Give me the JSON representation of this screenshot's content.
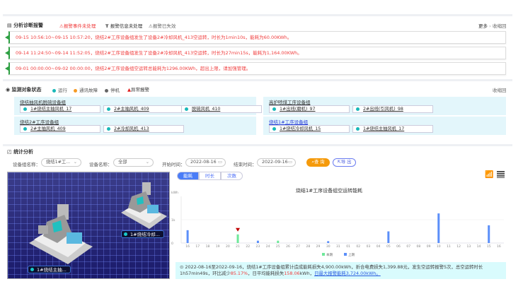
{
  "alarm_panel": {
    "title": "分析诊断报警",
    "filters": [
      {
        "label": "报警事件未处理",
        "icon": "warning-icon",
        "color": "#f04040"
      },
      {
        "label": "报警信息未处理",
        "icon": "text-icon",
        "color": "#333333"
      },
      {
        "label": "报警已失效",
        "icon": "warning-outline-icon",
        "color": "#666666"
      }
    ],
    "more": "更多",
    "collapse": "收缩回",
    "alarms": [
      "09-15 10:56:10~09-15 10:57:20，烧结2#工序设备组发生了设备2#冷却风机_413空运转，时长为1min10s，能耗为60.00KWh。",
      "09-14 11:24:50~09-14 11:52:05，烧结2#工序设备组发生了设备2#冷却风机_413空运转，时长为27min15s，能耗为1,164.00KWh。",
      "09-01 00:00:00~09-02 00:00:00，烧结2#工序设备组空运转总能耗为1296.00KWh，超出上限，请加强管理。"
    ]
  },
  "monitor_panel": {
    "title": "监测对象状态",
    "legend": [
      {
        "label": "运行",
        "color": "#19b8b8"
      },
      {
        "label": "通讯故障",
        "color": "#f59a23"
      },
      {
        "label": "停机",
        "color": "#666666"
      },
      {
        "label": "异常报警",
        "color": "#e02020"
      }
    ],
    "collapse": "收缩回",
    "groups": [
      {
        "name": "烧结抽风机脱硫设备组",
        "devices": [
          "1#烧结主抽风机_17",
          "2#主抽风机_409",
          "脱硫风机_410"
        ]
      },
      {
        "name": "高炉喷煤工序设备组",
        "devices": [
          "1#出线(磨机)_97",
          "2#出线(引风机)_98"
        ]
      },
      {
        "name": "烧结2#工序设备组",
        "devices": [
          "2#主抽风机_409",
          "2#冷却风机_413"
        ]
      },
      {
        "name": "烧结1#工序设备组",
        "devices": [
          "1#烧结冷却风机_15",
          "1#烧结主抽风机_17"
        ]
      }
    ]
  },
  "stats_panel": {
    "title": "统计分析",
    "group_label": "设备组名称：",
    "group_value": "烧结1#工...",
    "device_label": "设备名称：",
    "device_value": "全部",
    "start_label": "开始时间：",
    "start_value": "2022-08-16",
    "end_label": "结束时间：",
    "end_value": "2022-09-16",
    "query": "查 询",
    "export": "导 出",
    "tabs": [
      "能耗",
      "时长",
      "次数"
    ],
    "active_tab": 0,
    "scene_labels": [
      "1#烧结冷却...",
      "1#烧结主抽..."
    ],
    "summary": {
      "text": "2022-08-16至2022-09-16，烧结1#工序设备组累计造成能耗损失4,900.00kWh，折合电费损失1,399.88元，发生空运转报警5次，总空运转时长1h57min49s，环比减少",
      "pct": "85.17%",
      "mid": "，日平均能耗损失",
      "avg": "158.06",
      "unit": "kWh，",
      "link": "日最大报警能耗3,724.00kWh。"
    }
  },
  "chart_data": {
    "type": "bar",
    "title": "烧结1#工序设备组空运转能耗",
    "ylabel": "kWh",
    "yticks": [
      "0",
      "1k"
    ],
    "ylim": [
      0,
      2000
    ],
    "grid": true,
    "legend_position": "bottom",
    "categories": [
      "16",
      "17",
      "18",
      "19",
      "20",
      "21",
      "22",
      "23",
      "24",
      "25",
      "26",
      "27",
      "28",
      "29",
      "30",
      "31",
      "01",
      "02",
      "03",
      "04",
      "05",
      "06",
      "07",
      "08",
      "09",
      "10",
      "11",
      "12",
      "13",
      "14",
      "15",
      "16"
    ],
    "series": [
      {
        "name": "本期",
        "color": "#6ee89a",
        "values": [
          0,
          0,
          0,
          0,
          0,
          370,
          0,
          0,
          0,
          100,
          0,
          0,
          0,
          0,
          0,
          0,
          0,
          0,
          0,
          0,
          0,
          0,
          0,
          0,
          0,
          0,
          0,
          0,
          0,
          0,
          0,
          0
        ]
      },
      {
        "name": "上期",
        "color": "#5b8ff9",
        "values": [
          550,
          0,
          0,
          0,
          0,
          0,
          0,
          100,
          0,
          0,
          0,
          0,
          0,
          0,
          80,
          0,
          0,
          0,
          0,
          0,
          500,
          0,
          0,
          0,
          0,
          1270,
          0,
          0,
          0,
          0,
          760,
          0
        ]
      }
    ],
    "marker": {
      "category_index": 5,
      "color": "#c00000"
    }
  }
}
